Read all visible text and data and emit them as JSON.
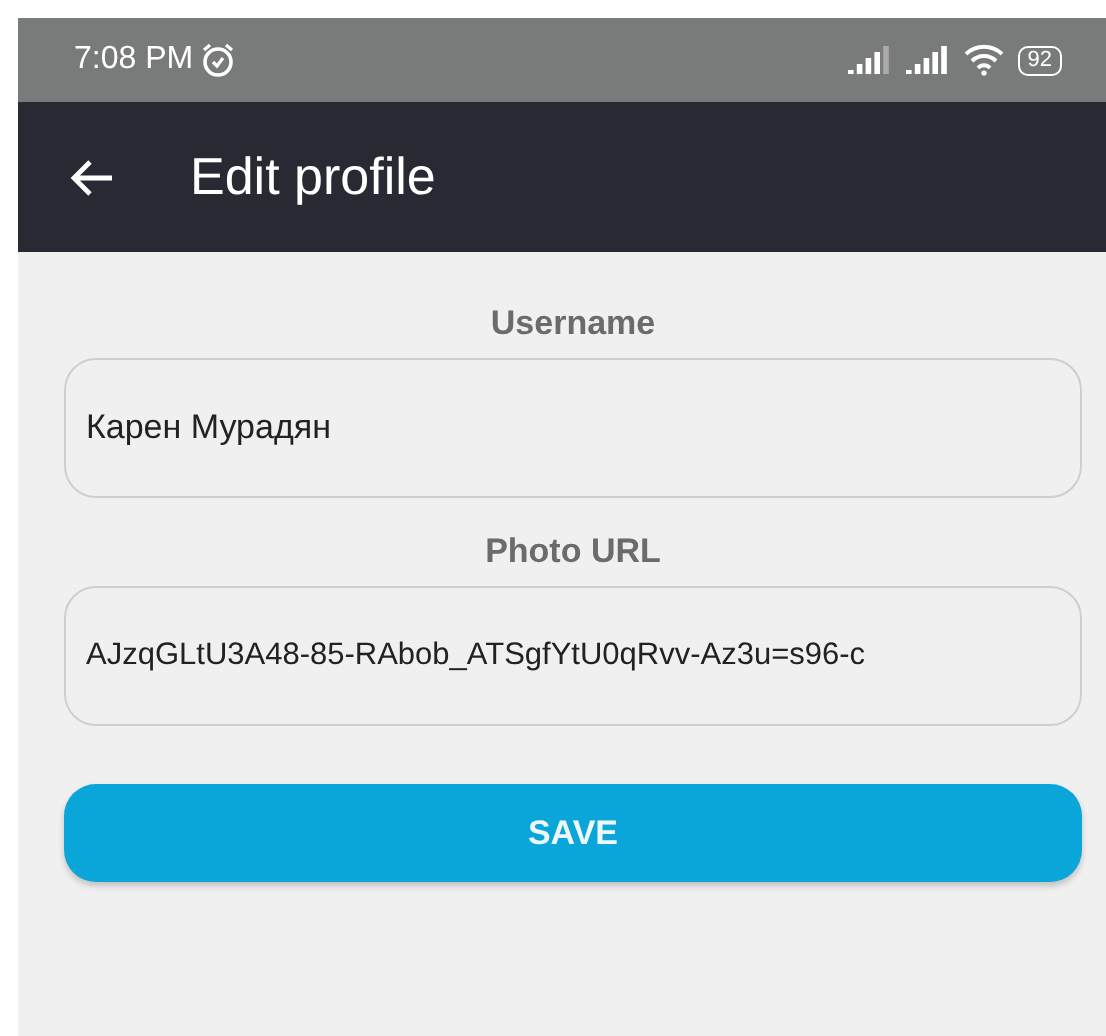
{
  "status_bar": {
    "time": "7:08 PM",
    "battery": "92"
  },
  "app_bar": {
    "title": "Edit profile"
  },
  "fields": [
    {
      "label": "Username",
      "value": "Карен Мурадян"
    },
    {
      "label": "Photo URL",
      "value": "AJzqGLtU3A48-85-RAbob_ATSgfYtU0qRvv-Az3u=s96-c"
    }
  ],
  "button": "SAVE"
}
